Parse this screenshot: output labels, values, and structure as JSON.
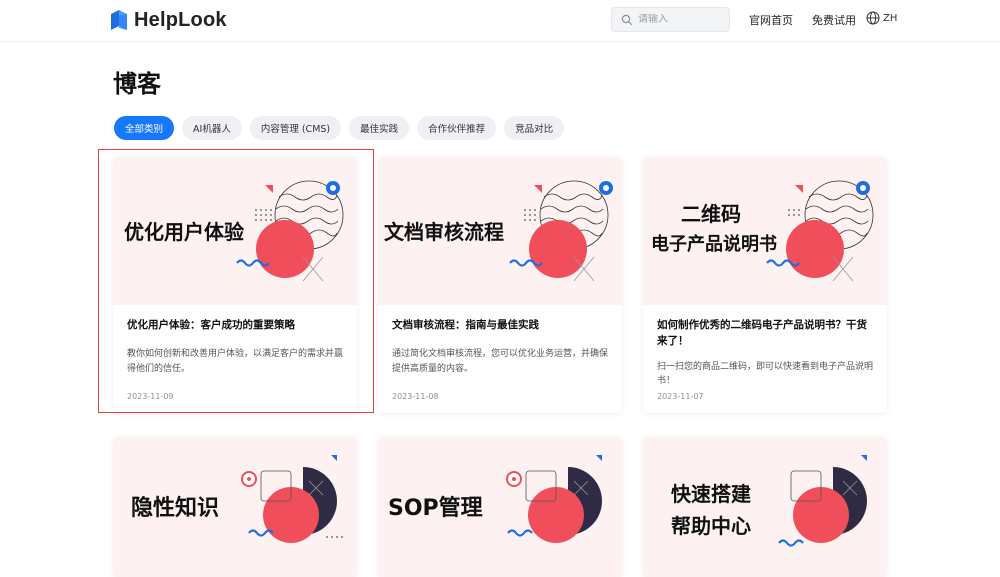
{
  "header": {
    "brand": "HelpLook",
    "search_placeholder": "请输入",
    "nav": [
      "官网首页",
      "免费试用"
    ],
    "lang": "ZH"
  },
  "page": {
    "title": "博客"
  },
  "filters": [
    {
      "label": "全部类别",
      "active": true
    },
    {
      "label": "AI机器人",
      "active": false
    },
    {
      "label": "内容管理 (CMS)",
      "active": false
    },
    {
      "label": "最佳实践",
      "active": false
    },
    {
      "label": "合作伙伴推荐",
      "active": false
    },
    {
      "label": "竞品对比",
      "active": false
    }
  ],
  "cards": [
    {
      "cover_lines": [
        "优化用户体验"
      ],
      "title": "优化用户体验：客户成功的重要策略",
      "desc": "教你如何创新和改善用户体验，以满足客户的需求并赢得他们的信任。",
      "date": "2023-11-09",
      "selected": true
    },
    {
      "cover_lines": [
        "文档审核流程"
      ],
      "title": "文档审核流程：指南与最佳实践",
      "desc": "通过简化文档审核流程，您可以优化业务运营，并确保提供高质量的内容。",
      "date": "2023-11-08"
    },
    {
      "cover_lines": [
        "二维码",
        "电子产品说明书"
      ],
      "title": "如何制作优秀的二维码电子产品说明书？干货来了！",
      "desc": "扫一扫您的商品二维码，即可以快速看到电子产品说明书！",
      "date": "2023-11-07"
    },
    {
      "cover_lines": [
        "隐性知识"
      ]
    },
    {
      "cover_lines": [
        "SOP管理"
      ]
    },
    {
      "cover_lines": [
        "快速搭建",
        "帮助中心"
      ]
    }
  ],
  "colors": {
    "accent": "#1677ff",
    "highlight": "#e0413b",
    "cover_bg": "#fdf1f1",
    "coral": "#ef4e5a"
  }
}
